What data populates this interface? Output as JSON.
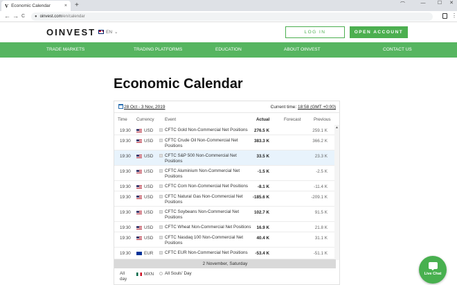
{
  "browser": {
    "tab_favicon": "V",
    "tab_title": "Economic Calendar",
    "tab_close": "×",
    "new_tab": "+",
    "url_host": "oinvest.com",
    "url_path": "/en/calendar",
    "back": "←",
    "forward": "→",
    "reload": "C",
    "lock": "🔒",
    "menu": "⋮",
    "minimize": "—",
    "maximize": "☐",
    "close": "✕"
  },
  "header": {
    "logo": "OINVEST",
    "lang": "EN",
    "lang_chevron": "⌄",
    "login": "LOG IN",
    "open_account": "OPEN ACCOUNT"
  },
  "nav": {
    "items": [
      "TRADE MARKETS",
      "TRADING PLATFORMS",
      "EDUCATION",
      "ABOUT OINVEST",
      "CONTACT US"
    ]
  },
  "page": {
    "title": "Economic Calendar"
  },
  "calendar": {
    "date_range": "28 Oct - 3 Nov, 2019",
    "current_time_label": "Current time:",
    "current_time_value": "18:58 (GMT +0:00)",
    "columns": [
      "Time",
      "Currency",
      "Event",
      "Actual",
      "Forecast",
      "Previous"
    ],
    "rows": [
      {
        "time": "19:30",
        "currency": "USD",
        "event": "CFTC Gold Non-Commercial Net Positions",
        "actual": "276.5 K",
        "previous": "259.1 K"
      },
      {
        "time": "19:30",
        "currency": "USD",
        "event": "CFTC Crude Oil Non-Commercial Net Positions",
        "actual": "383.3 K",
        "previous": "366.2 K"
      },
      {
        "time": "19:30",
        "currency": "USD",
        "event": "CFTC S&P 500 Non-Commercial Net Positions",
        "actual": "33.5 K",
        "previous": "23.3 K"
      },
      {
        "time": "19:30",
        "currency": "USD",
        "event": "CFTC Aluminium Non-Commercial Net Positions",
        "actual": "-1.5 K",
        "previous": "-2.5 K"
      },
      {
        "time": "19:30",
        "currency": "USD",
        "event": "CFTC Corn Non-Commercial Net Positions",
        "actual": "-8.1 K",
        "previous": "-11.4 K"
      },
      {
        "time": "19:30",
        "currency": "USD",
        "event": "CFTC Natural Gas Non-Commercial Net Positions",
        "actual": "-185.6 K",
        "previous": "-209.1 K"
      },
      {
        "time": "19:30",
        "currency": "USD",
        "event": "CFTC Soybeans Non-Commercial Net Positions",
        "actual": "102.7 K",
        "previous": "91.5 K"
      },
      {
        "time": "19:30",
        "currency": "USD",
        "event": "CFTC Wheat Non-Commercial Net Positions",
        "actual": "16.9 K",
        "previous": "21.8 K"
      },
      {
        "time": "19:30",
        "currency": "USD",
        "event": "CFTC Nasdaq 100 Non-Commercial Net Positions",
        "actual": "40.4 K",
        "previous": "31.1 K"
      },
      {
        "time": "19:30",
        "currency": "EUR",
        "event": "CFTC EUR Non-Commercial Net Positions",
        "actual": "-53.4 K",
        "previous": "-51.1 K"
      }
    ],
    "day_separator": "2 November, Saturday",
    "holiday": {
      "time": "All day",
      "currency": "MXN",
      "event": "All Souls' Day"
    },
    "scroll_up": "▲"
  },
  "live_chat": {
    "label": "Live Chat"
  }
}
